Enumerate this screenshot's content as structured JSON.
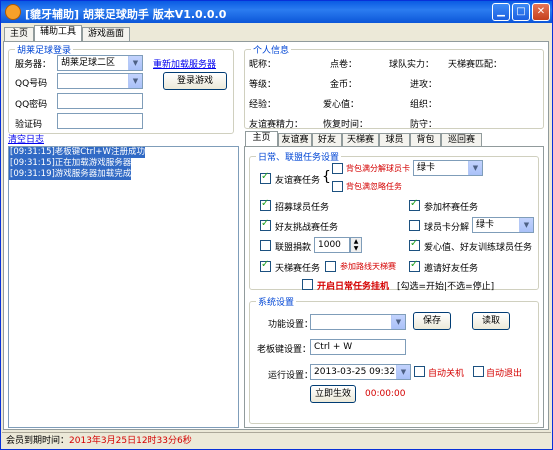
{
  "window": {
    "title": "[貔牙辅助] 胡莱足球助手    版本V1.0.0.0"
  },
  "main_tabs": [
    "主页",
    "辅助工具",
    "游戏画面"
  ],
  "login": {
    "group_title": "胡莱足球登录",
    "server_label": "服务器：",
    "server_value": "胡莱足球二区",
    "reload_link": "重新加载服务器",
    "qq_label": "QQ号码",
    "pwd_label": "QQ密码",
    "captcha_label": "验证码",
    "login_button": "登录游戏"
  },
  "profile": {
    "group_title": "个人信息",
    "rows": [
      [
        "昵称：",
        "点卷：",
        "球队实力：",
        "天梯赛匹配："
      ],
      [
        "等级：",
        "金币：",
        "",
        "进攻："
      ],
      [
        "经验：",
        "爱心值：",
        "",
        "组织："
      ],
      [
        "友谊赛精力：",
        "恢复时间：",
        "",
        "防守："
      ]
    ]
  },
  "log": {
    "clear_link": "清空日志",
    "lines": [
      "[09:31:15]老板键Ctrl+W注册成功",
      "[09:31:15]正在加载游戏服务器",
      "[09:31:19]游戏服务器加载完成"
    ]
  },
  "sub_tabs": [
    "主页",
    "友谊赛",
    "好友",
    "天梯赛",
    "球员",
    "背包",
    "巡回赛"
  ],
  "tasks": {
    "group_title": "日常、联盟任务设置",
    "friendly": "友谊赛任务",
    "bag_full_sell": "背包满分解球员卡",
    "bag_full_sell_value": "绿卡",
    "bag_full_ignore": "背包满忽略任务",
    "recruit": "招募球员任务",
    "cup": "参加杯赛任务",
    "friend_challenge": "好友挑战赛任务",
    "card_split": "球员卡分解",
    "card_split_value": "绿卡",
    "league_donate": "联盟捐款",
    "donate_value": "1000",
    "love_train": "爱心值、好友训练球员任务",
    "ladder": "天梯赛任务",
    "ladder_extra": "参加路线天梯赛",
    "invite": "邀请好友任务",
    "start": "开启日常任务挂机",
    "start_hint": "[勾选=开始|不选=停止]"
  },
  "system": {
    "group_title": "系统设置",
    "func_label": "功能设置：",
    "func_value": "",
    "save_button": "保存",
    "read_button": "读取",
    "boss_label": "老板键设置：",
    "boss_value": "Ctrl + W",
    "run_label": "运行设置：",
    "run_value": "2013-03-25 09:32:10",
    "auto_shutdown": "自动关机",
    "auto_exit": "自动退出",
    "apply_button": "立即生效",
    "timer": "00:00:00"
  },
  "status": {
    "label": "会员到期时间：",
    "value": "2013年3月25日12时33分6秒"
  }
}
